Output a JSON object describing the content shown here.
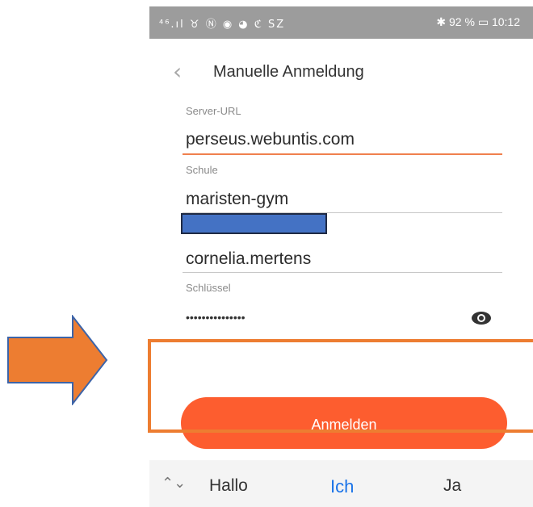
{
  "statusbar": {
    "left_icons": "⁴⁶.ıl ♉ Ⓝ ◉ ◕ ℭ SZ",
    "right": "✱ ⋙ 92 % ▭ 10:12",
    "battery_percent": "92 %",
    "time": "10:12"
  },
  "header": {
    "title": "Manuelle Anmeldung"
  },
  "form": {
    "server_label": "Server-URL",
    "server_value": "perseus.webuntis.com",
    "school_label": "Schule",
    "school_value": "maristen-gym",
    "username_value": "cornelia.mertens",
    "key_label": "Schlüssel",
    "key_masked": "•••••••••••••••"
  },
  "login_button": "Anmelden",
  "suggestions": [
    "Hallo",
    "Ich",
    "Ja"
  ],
  "colors": {
    "accent": "#fd5d2f",
    "annotation": "#ed7d31",
    "redaction": "#4472c4",
    "suggest_active": "#1a73e8"
  }
}
